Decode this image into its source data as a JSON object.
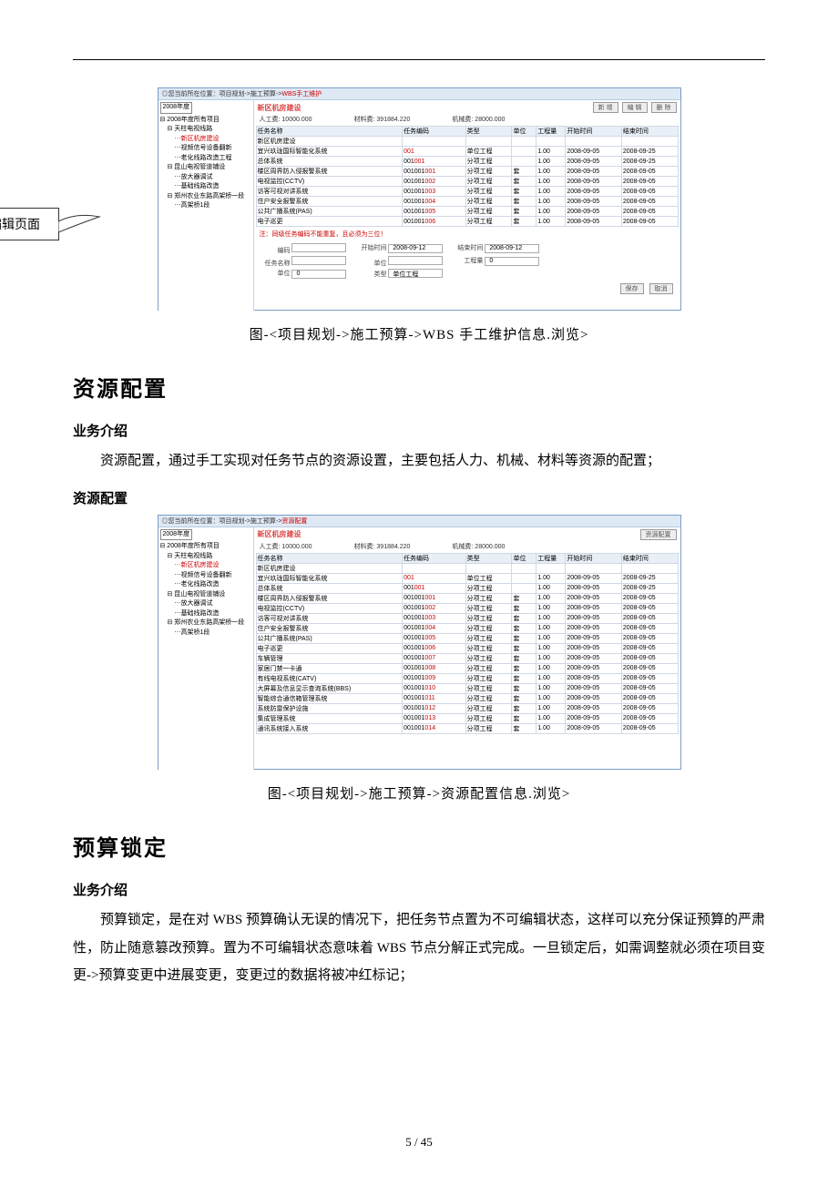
{
  "screenshot1": {
    "breadcrumb_prefix": "您当前所在位置：项目规划->施工预算->",
    "breadcrumb_leaf": "WBS手工维护",
    "year": "2008年度",
    "tree": [
      {
        "label": "2008年度所有项目",
        "lvl": 0,
        "red": false
      },
      {
        "label": "天柱电视线路",
        "lvl": 1,
        "red": false
      },
      {
        "label": "新区机房建设",
        "lvl": 2,
        "red": true
      },
      {
        "label": "视频信号设备翻新",
        "lvl": 2,
        "red": false
      },
      {
        "label": "老化线路改造工程",
        "lvl": 2,
        "red": false
      },
      {
        "label": "昆山电视管道铺设",
        "lvl": 1,
        "red": false
      },
      {
        "label": "放大器调试",
        "lvl": 2,
        "red": false
      },
      {
        "label": "基础线路改造",
        "lvl": 2,
        "red": false
      },
      {
        "label": "郑州农业东路高架桥一段",
        "lvl": 1,
        "red": false
      },
      {
        "label": "高架桥1段",
        "lvl": 2,
        "red": false
      }
    ],
    "title": "新区机房建设",
    "buttons": [
      "新 增",
      "编 辑",
      "删 除"
    ],
    "summary": {
      "labor_label": "人工费:",
      "labor_value": "10000.000",
      "material_label": "材料费:",
      "material_value": "391884.220",
      "machine_label": "机械费:",
      "machine_value": "28000.000"
    },
    "columns": [
      "任务名称",
      "任务编码",
      "类型",
      "单位",
      "工程量",
      "开始时间",
      "结束时间"
    ],
    "rows": [
      {
        "name": "新区机房建设",
        "code": "",
        "code_red": "",
        "type": "",
        "unit": "",
        "qty": "",
        "start": "",
        "end": ""
      },
      {
        "name": "宜兴玖珑国际智能化系统",
        "code": "",
        "code_red": "001",
        "type": "单位工程",
        "unit": "",
        "qty": "1.00",
        "start": "2008-09-05",
        "end": "2008-09-25"
      },
      {
        "name": "总体系统",
        "code": "001",
        "code_red": "001",
        "type": "分项工程",
        "unit": "",
        "qty": "1.00",
        "start": "2008-09-05",
        "end": "2008-09-25"
      },
      {
        "name": "楼区周界防入侵报警系统",
        "code": "001001",
        "code_red": "001",
        "type": "分项工程",
        "unit": "套",
        "qty": "1.00",
        "start": "2008-09-05",
        "end": "2008-09-05"
      },
      {
        "name": "电视监控(CCTV)",
        "code": "001001",
        "code_red": "002",
        "type": "分项工程",
        "unit": "套",
        "qty": "1.00",
        "start": "2008-09-05",
        "end": "2008-09-05"
      },
      {
        "name": "访客可视对讲系统",
        "code": "001001",
        "code_red": "003",
        "type": "分项工程",
        "unit": "套",
        "qty": "1.00",
        "start": "2008-09-05",
        "end": "2008-09-05"
      },
      {
        "name": "住户安全报警系统",
        "code": "001001",
        "code_red": "004",
        "type": "分项工程",
        "unit": "套",
        "qty": "1.00",
        "start": "2008-09-05",
        "end": "2008-09-05"
      },
      {
        "name": "公共广播系统(PAS)",
        "code": "001001",
        "code_red": "005",
        "type": "分项工程",
        "unit": "套",
        "qty": "1.00",
        "start": "2008-09-05",
        "end": "2008-09-05"
      },
      {
        "name": "电子巡更",
        "code": "001001",
        "code_red": "006",
        "type": "分项工程",
        "unit": "套",
        "qty": "1.00",
        "start": "2008-09-05",
        "end": "2008-09-05"
      }
    ],
    "note": "注：同级任务编码不能重复，且必须为三位！",
    "form": {
      "code_label": "编码",
      "start_label": "开始时间",
      "start_val": "2008-09-12",
      "end_label": "结束时间",
      "end_val": "2008-09-12",
      "task_label": "任务名称",
      "unit_label": "单位",
      "qty_label": "工程量",
      "qty_val": "0",
      "type_label": "类型",
      "type_val": "单位工程",
      "unit2_label": "单位",
      "unit2_val": "0"
    },
    "bottom_buttons": [
      "保存",
      "取消"
    ]
  },
  "callout_text": "新增，编辑页面",
  "caption1": "图-<项目规划->施工预算->WBS 手工维护信息.浏览>",
  "section1": "资源配置",
  "subhead1": "业务介绍",
  "para1": "资源配置，通过手工实现对任务节点的资源设置，主要包括人力、机械、材料等资源的配置；",
  "subhead2": "资源配置",
  "screenshot2": {
    "breadcrumb_prefix": "您当前所在位置：项目规划->施工预算->",
    "breadcrumb_leaf": "资源配置",
    "year": "2008年度",
    "tree": [
      {
        "label": "2008年度所有项目",
        "lvl": 0,
        "red": false
      },
      {
        "label": "天柱电视线路",
        "lvl": 1,
        "red": false
      },
      {
        "label": "新区机房建设",
        "lvl": 2,
        "red": true
      },
      {
        "label": "视频信号设备翻新",
        "lvl": 2,
        "red": false
      },
      {
        "label": "老化线路改造",
        "lvl": 2,
        "red": false
      },
      {
        "label": "昆山电视管道铺设",
        "lvl": 1,
        "red": false
      },
      {
        "label": "放大器调试",
        "lvl": 2,
        "red": false
      },
      {
        "label": "基础线路改造",
        "lvl": 2,
        "red": false
      },
      {
        "label": "郑州农业东路高架桥一段",
        "lvl": 1,
        "red": false
      },
      {
        "label": "高架桥1段",
        "lvl": 2,
        "red": false
      }
    ],
    "title": "新区机房建设",
    "buttons": [
      "资源配置"
    ],
    "summary": {
      "labor_label": "人工费:",
      "labor_value": "10000.000",
      "material_label": "材料费:",
      "material_value": "391884.220",
      "machine_label": "机械费:",
      "machine_value": "28000.000"
    },
    "columns": [
      "任务名称",
      "任务编码",
      "类型",
      "单位",
      "工程量",
      "开始时间",
      "结束时间"
    ],
    "rows": [
      {
        "name": "新区机房建设",
        "code": "",
        "code_red": "",
        "type": "",
        "unit": "",
        "qty": "",
        "start": "",
        "end": ""
      },
      {
        "name": "宜兴玖珑国际智能化系统",
        "code": "",
        "code_red": "001",
        "type": "单位工程",
        "unit": "",
        "qty": "1.00",
        "start": "2008-09-05",
        "end": "2008-09-25"
      },
      {
        "name": "总体系统",
        "code": "001",
        "code_red": "001",
        "type": "分项工程",
        "unit": "",
        "qty": "1.00",
        "start": "2008-09-05",
        "end": "2008-09-25"
      },
      {
        "name": "楼区周界防入侵报警系统",
        "code": "001001",
        "code_red": "001",
        "type": "分项工程",
        "unit": "套",
        "qty": "1.00",
        "start": "2008-09-05",
        "end": "2008-09-05"
      },
      {
        "name": "电视监控(CCTV)",
        "code": "001001",
        "code_red": "002",
        "type": "分项工程",
        "unit": "套",
        "qty": "1.00",
        "start": "2008-09-05",
        "end": "2008-09-05"
      },
      {
        "name": "访客可视对讲系统",
        "code": "001001",
        "code_red": "003",
        "type": "分项工程",
        "unit": "套",
        "qty": "1.00",
        "start": "2008-09-05",
        "end": "2008-09-05"
      },
      {
        "name": "住户安全报警系统",
        "code": "001001",
        "code_red": "004",
        "type": "分项工程",
        "unit": "套",
        "qty": "1.00",
        "start": "2008-09-05",
        "end": "2008-09-05"
      },
      {
        "name": "公共广播系统(PAS)",
        "code": "001001",
        "code_red": "005",
        "type": "分项工程",
        "unit": "套",
        "qty": "1.00",
        "start": "2008-09-05",
        "end": "2008-09-05"
      },
      {
        "name": "电子巡更",
        "code": "001001",
        "code_red": "006",
        "type": "分项工程",
        "unit": "套",
        "qty": "1.00",
        "start": "2008-09-05",
        "end": "2008-09-05"
      },
      {
        "name": "车辆管理",
        "code": "001001",
        "code_red": "007",
        "type": "分项工程",
        "unit": "套",
        "qty": "1.00",
        "start": "2008-09-05",
        "end": "2008-09-05"
      },
      {
        "name": "家居门禁一卡通",
        "code": "001001",
        "code_red": "008",
        "type": "分项工程",
        "unit": "套",
        "qty": "1.00",
        "start": "2008-09-05",
        "end": "2008-09-05"
      },
      {
        "name": "有线电视系统(CATV)",
        "code": "001001",
        "code_red": "009",
        "type": "分项工程",
        "unit": "套",
        "qty": "1.00",
        "start": "2008-09-05",
        "end": "2008-09-05"
      },
      {
        "name": "大屏幕及信息显示查询系统(BBS)",
        "code": "001001",
        "code_red": "010",
        "type": "分项工程",
        "unit": "套",
        "qty": "1.00",
        "start": "2008-09-05",
        "end": "2008-09-05"
      },
      {
        "name": "智能综合通信箱管理系统",
        "code": "001001",
        "code_red": "011",
        "type": "分项工程",
        "unit": "套",
        "qty": "1.00",
        "start": "2008-09-05",
        "end": "2008-09-05"
      },
      {
        "name": "系统防雷保护设施",
        "code": "001001",
        "code_red": "012",
        "type": "分项工程",
        "unit": "套",
        "qty": "1.00",
        "start": "2008-09-05",
        "end": "2008-09-05"
      },
      {
        "name": "集成管理系统",
        "code": "001001",
        "code_red": "013",
        "type": "分项工程",
        "unit": "套",
        "qty": "1.00",
        "start": "2008-09-05",
        "end": "2008-09-05"
      },
      {
        "name": "通讯系统接入系统",
        "code": "001001",
        "code_red": "014",
        "type": "分项工程",
        "unit": "套",
        "qty": "1.00",
        "start": "2008-09-05",
        "end": "2008-09-05"
      }
    ]
  },
  "caption2": "图-<项目规划->施工预算->资源配置信息.浏览>",
  "section2": "预算锁定",
  "subhead3": "业务介绍",
  "para2": "预算锁定，是在对 WBS 预算确认无误的情况下，把任务节点置为不可编辑状态，这样可以充分保证预算的严肃性，防止随意篡改预算。置为不可编辑状态意味着 WBS 节点分解正式完成。一旦锁定后，如需调整就必须在项目变更->预算变更中进展变更，变更过的数据将被冲红标记；",
  "page_num": "5  /  45"
}
